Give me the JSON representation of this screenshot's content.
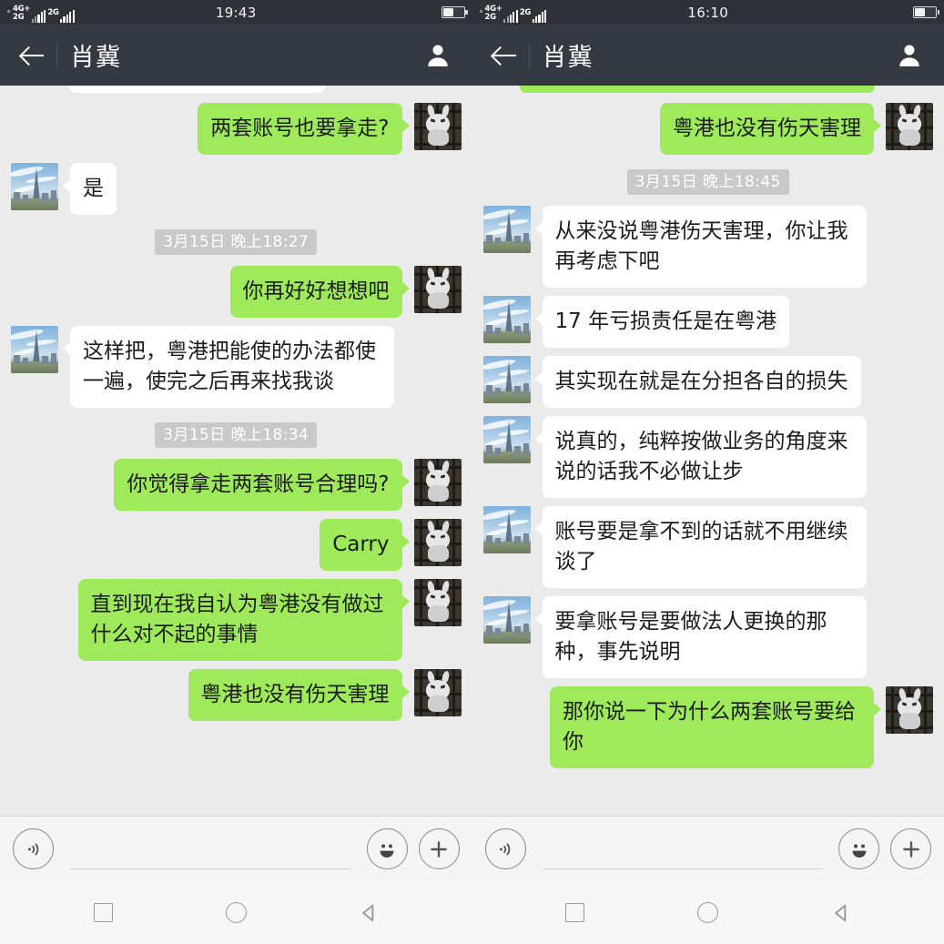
{
  "panels": [
    {
      "id": "left",
      "status": {
        "sim1_label_top": "4G+",
        "sim1_label_bottom": "2G",
        "sim2_label": "2G",
        "time": "19:43",
        "battery_icon": "battery-half-icon"
      },
      "appbar": {
        "back_icon": "back-arrow-icon",
        "title": "肖冀",
        "profile_icon": "contact-profile-icon"
      },
      "messages": [
        {
          "type": "partial",
          "side": "in",
          "style": "white"
        },
        {
          "type": "msg",
          "side": "out",
          "text": "两套账号也要拿走?"
        },
        {
          "type": "msg",
          "side": "in",
          "text": "是"
        },
        {
          "type": "time",
          "text": "3月15日 晚上18:27"
        },
        {
          "type": "msg",
          "side": "out",
          "text": "你再好好想想吧"
        },
        {
          "type": "msg",
          "side": "in",
          "text": "这样把，粤港把能使的办法都使一遍，使完之后再来找我谈"
        },
        {
          "type": "time",
          "text": "3月15日 晚上18:34"
        },
        {
          "type": "msg",
          "side": "out",
          "text": "你觉得拿走两套账号合理吗?"
        },
        {
          "type": "msg",
          "side": "out",
          "text": "Carry"
        },
        {
          "type": "msg",
          "side": "out",
          "text": "直到现在我自认为粤港没有做过什么对不起的事情"
        },
        {
          "type": "msg",
          "side": "out",
          "text": "粤港也没有伤天害理"
        }
      ],
      "input": {
        "voice_icon": "voice-input-icon",
        "placeholder": "",
        "value": "",
        "emoji_icon": "emoji-smile-icon",
        "plus_icon": "add-plus-icon"
      },
      "nav": {
        "recents_icon": "recents-square-icon",
        "home_icon": "home-circle-icon",
        "back_icon": "back-triangle-icon"
      }
    },
    {
      "id": "right",
      "status": {
        "sim1_label_top": "4G+",
        "sim1_label_bottom": "2G",
        "sim2_label": "2G",
        "time": "16:10",
        "battery_icon": "battery-half-icon"
      },
      "appbar": {
        "back_icon": "back-arrow-icon",
        "title": "肖冀",
        "profile_icon": "contact-profile-icon"
      },
      "messages": [
        {
          "type": "partial",
          "side": "out",
          "style": "green"
        },
        {
          "type": "msg",
          "side": "out",
          "text": "粤港也没有伤天害理"
        },
        {
          "type": "time",
          "text": "3月15日 晚上18:45"
        },
        {
          "type": "msg",
          "side": "in",
          "text": "从来没说粤港伤天害理，你让我再考虑下吧"
        },
        {
          "type": "msg",
          "side": "in",
          "text": "17 年亏损责任是在粤港"
        },
        {
          "type": "msg",
          "side": "in",
          "text": "其实现在就是在分担各自的损失"
        },
        {
          "type": "msg",
          "side": "in",
          "text": "说真的，纯粹按做业务的角度来说的话我不必做让步"
        },
        {
          "type": "msg",
          "side": "in",
          "text": "账号要是拿不到的话就不用继续谈了"
        },
        {
          "type": "msg",
          "side": "in",
          "text": "要拿账号是要做法人更换的那种，事先说明"
        },
        {
          "type": "msg",
          "side": "out",
          "text": "那你说一下为什么两套账号要给你"
        }
      ],
      "input": {
        "voice_icon": "voice-input-icon",
        "placeholder": "",
        "value": "",
        "emoji_icon": "emoji-smile-icon",
        "plus_icon": "add-plus-icon"
      },
      "nav": {
        "recents_icon": "recents-square-icon",
        "home_icon": "home-circle-icon",
        "back_icon": "back-triangle-icon"
      }
    }
  ],
  "colors": {
    "outgoing_bubble": "#9eea5a",
    "incoming_bubble": "#ffffff",
    "chat_background": "#ebebeb",
    "appbar": "#353a42",
    "statusbar": "#2f3238",
    "timestamp_pill": "#c9c9c9"
  }
}
